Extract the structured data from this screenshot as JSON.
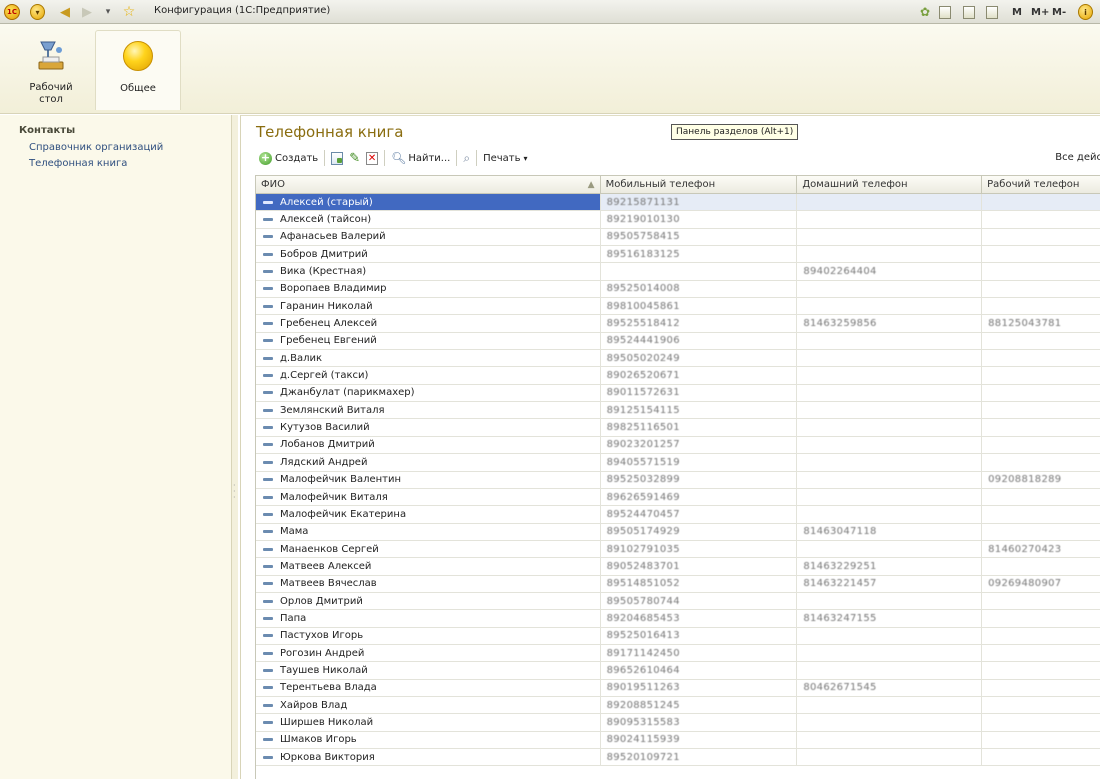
{
  "window": {
    "title": "Конфигурация (1С:Предприятие)",
    "logo_text": "1С",
    "right_buttons": [
      "M",
      "M+",
      "M-"
    ]
  },
  "sections": [
    {
      "label_line1": "Рабочий",
      "label_line2": "стол"
    },
    {
      "label_line1": "Общее",
      "label_line2": ""
    }
  ],
  "nav": {
    "header": "Контакты",
    "items": [
      "Справочник организаций",
      "Телефонная книга"
    ]
  },
  "main": {
    "title": "Телефонная книга",
    "tooltip": "Панель разделов (Alt+1)",
    "toolbar": {
      "create": "Создать",
      "find": "Найти...",
      "print": "Печать",
      "all_actions": "Все дейс"
    },
    "columns": [
      "ФИО",
      "Мобильный телефон",
      "Домашний телефон",
      "Рабочий телефон"
    ],
    "rows": [
      {
        "name": "Алексей (старый)",
        "mobile": "89215871131",
        "home": "",
        "work": ""
      },
      {
        "name": "Алексей (тайсон)",
        "mobile": "89219010130",
        "home": "",
        "work": ""
      },
      {
        "name": "Афанасьев Валерий",
        "mobile": "89505758415",
        "home": "",
        "work": ""
      },
      {
        "name": "Бобров Дмитрий",
        "mobile": "89516183125",
        "home": "",
        "work": ""
      },
      {
        "name": "Вика (Крестная)",
        "mobile": "",
        "home": "89402264404",
        "work": ""
      },
      {
        "name": "Воропаев Владимир",
        "mobile": "89525014008",
        "home": "",
        "work": ""
      },
      {
        "name": "Гаранин Николай",
        "mobile": "89810045861",
        "home": "",
        "work": ""
      },
      {
        "name": "Гребенец Алексей",
        "mobile": "89525518412",
        "home": "81463259856",
        "work": "88125043781"
      },
      {
        "name": "Гребенец Евгений",
        "mobile": "89524441906",
        "home": "",
        "work": ""
      },
      {
        "name": "д.Валик",
        "mobile": "89505020249",
        "home": "",
        "work": ""
      },
      {
        "name": "д.Сергей (такси)",
        "mobile": "89026520671",
        "home": "",
        "work": ""
      },
      {
        "name": "Джанбулат (парикмахер)",
        "mobile": "89011572631",
        "home": "",
        "work": ""
      },
      {
        "name": "Землянский Виталя",
        "mobile": "89125154115",
        "home": "",
        "work": ""
      },
      {
        "name": "Кутузов Василий",
        "mobile": "89825116501",
        "home": "",
        "work": ""
      },
      {
        "name": "Лобанов Дмитрий",
        "mobile": "89023201257",
        "home": "",
        "work": ""
      },
      {
        "name": "Лядский Андрей",
        "mobile": "89405571519",
        "home": "",
        "work": ""
      },
      {
        "name": "Малофейчик Валентин",
        "mobile": "89525032899",
        "home": "",
        "work": "09208818289"
      },
      {
        "name": "Малофейчик Виталя",
        "mobile": "89626591469",
        "home": "",
        "work": ""
      },
      {
        "name": "Малофейчик Екатерина",
        "mobile": "89524470457",
        "home": "",
        "work": ""
      },
      {
        "name": "Мама",
        "mobile": "89505174929",
        "home": "81463047118",
        "work": ""
      },
      {
        "name": "Манаенков Сергей",
        "mobile": "89102791035",
        "home": "",
        "work": "81460270423"
      },
      {
        "name": "Матвеев Алексей",
        "mobile": "89052483701",
        "home": "81463229251",
        "work": ""
      },
      {
        "name": "Матвеев Вячеслав",
        "mobile": "89514851052",
        "home": "81463221457",
        "work": "09269480907"
      },
      {
        "name": "Орлов Дмитрий",
        "mobile": "89505780744",
        "home": "",
        "work": ""
      },
      {
        "name": "Папа",
        "mobile": "89204685453",
        "home": "81463247155",
        "work": ""
      },
      {
        "name": "Пастухов Игорь",
        "mobile": "89525016413",
        "home": "",
        "work": ""
      },
      {
        "name": "Рогозин Андрей",
        "mobile": "89171142450",
        "home": "",
        "work": ""
      },
      {
        "name": "Таушев Николай",
        "mobile": "89652610464",
        "home": "",
        "work": ""
      },
      {
        "name": "Терентьева Влада",
        "mobile": "89019511263",
        "home": "80462671545",
        "work": ""
      },
      {
        "name": "Хайров Влад",
        "mobile": "89208851245",
        "home": "",
        "work": ""
      },
      {
        "name": "Ширшев Николай",
        "mobile": "89095315583",
        "home": "",
        "work": ""
      },
      {
        "name": "Шмаков Игорь",
        "mobile": "89024115939",
        "home": "",
        "work": ""
      },
      {
        "name": "Юркова Виктория",
        "mobile": "89520109721",
        "home": "",
        "work": ""
      }
    ]
  }
}
